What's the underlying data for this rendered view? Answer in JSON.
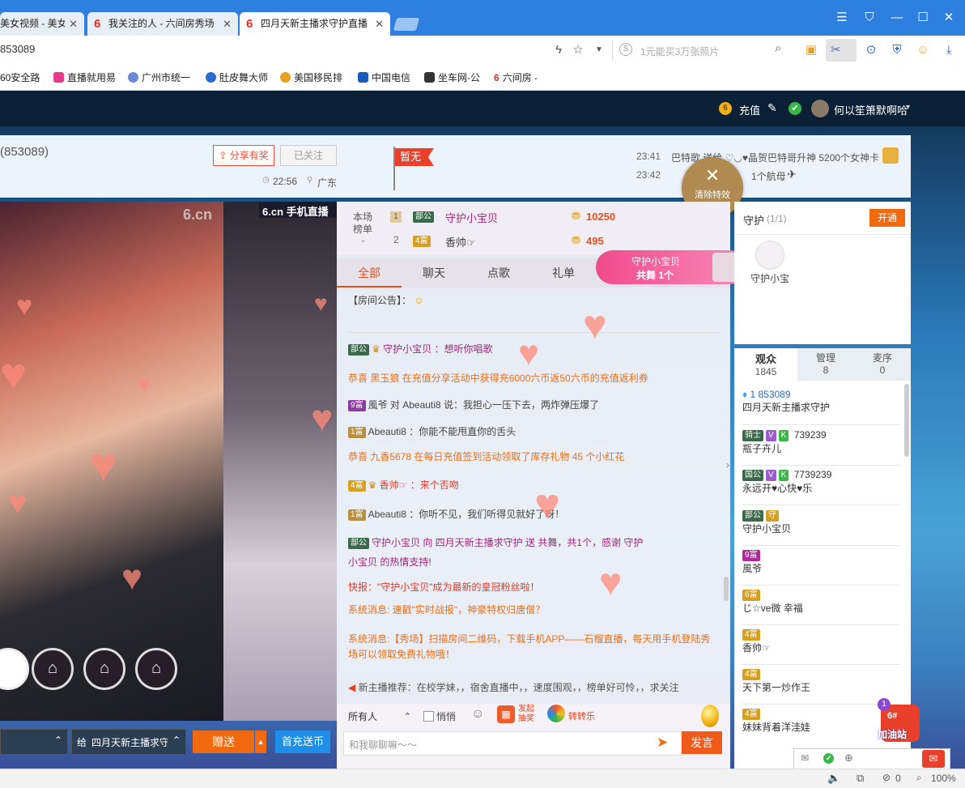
{
  "browser": {
    "tabs": [
      {
        "label": "美女视频 - 美女"
      },
      {
        "label": "我关注的人 - 六间房秀场"
      },
      {
        "label": "四月天新主播求守护直播"
      }
    ],
    "url": "853089",
    "search_placeholder": "1元能买3万张照片",
    "bookmarks": [
      "60安全路",
      "直播就用易",
      "广州市统一",
      "肚皮舞大师",
      "美国移民排",
      "中国电信",
      "坐车网-公",
      "六间房 -"
    ],
    "status": {
      "count": "0",
      "zoom": "100%"
    }
  },
  "site": {
    "recharge": "充值",
    "username": "何以笙箫默啊哈",
    "coin_icon_text": "6"
  },
  "room": {
    "id": "(853089)",
    "share_btn": "分享有奖",
    "followed_btn": "已关注",
    "time": "22:56",
    "location": "广东",
    "flag": "暂无",
    "notices": [
      {
        "time": "23:41",
        "text": "巴特歌 送给 ♡◡♥晶贺巴特哥升神 5200个女神卡"
      },
      {
        "time": "23:42",
        "text": "1个航母"
      }
    ],
    "clear_effects": "清除特效",
    "video_logo": "6.cn",
    "mobile_tag": "6.cn 手机直播"
  },
  "rank": {
    "label1": "本场",
    "label2": "榜单",
    "rows": [
      {
        "rank": "1",
        "badge": "部公",
        "name": "守护小宝贝",
        "score": "10250"
      },
      {
        "rank": "2",
        "badge": "4富",
        "name": "香帅☞",
        "score": "495"
      }
    ]
  },
  "chat_tabs": [
    "全部",
    "聊天",
    "点歌",
    "礼单"
  ],
  "dance_banner": {
    "name": "守护小宝贝",
    "line2": "共舞 1个"
  },
  "chat": [
    {
      "text": "【房间公告】：",
      "cls": ""
    },
    {
      "text": "守护小宝贝 ：想听你唱歌",
      "cls": "purple"
    },
    {
      "text": "恭喜 黑玉狼 在充值分享活动中获得充6000六币返50六币的充值返利券",
      "cls": "orange"
    },
    {
      "text": "風爷 对 Abeauti8 说：我担心一压下去，两炸弹压爆了",
      "cls": ""
    },
    {
      "text": "Abeauti8 ：你能不能甩直你的舌头",
      "cls": ""
    },
    {
      "text": "恭喜 九香5678 在每日充值签到活动领取了库存礼物 45 个小红花",
      "cls": "orange"
    },
    {
      "text": "香帅☞ ：来个否吻",
      "cls": "red"
    },
    {
      "text": "Abeauti8 ：你听不见，我们听得见就好了呀！",
      "cls": ""
    },
    {
      "text": "守护小宝贝 向 四月天新主播求守护 送 共舞，共1个，感谢 守护",
      "cls": "purple"
    },
    {
      "text": "小宝贝 的热情支持!",
      "cls": "purple"
    },
    {
      "text": "快报：\"守护小宝贝\"成为最新的皇冠粉丝啦！",
      "cls": "red"
    },
    {
      "text": "系统消息: 速戳\"实时战报\"，神豪特权归唐僧？",
      "cls": "orange"
    },
    {
      "text": "系统消息:【秀场】扫描房间二维码，下载手机APP——石榴直播，每天用手机登陆秀",
      "cls": "orange"
    },
    {
      "text": "场可以领取免费礼物哦！",
      "cls": "orange"
    }
  ],
  "recommend": "新主播推荐：在校学妹，，宿舍直播中，，速度围观，，榜单好可怜，，求关注",
  "chat_input": {
    "target": "所有人",
    "private": "悄悄",
    "launch": "发起抽奖",
    "spin": "转转乐",
    "placeholder": "和我聊聊嘛～～",
    "send": "发言"
  },
  "gift_bar": {
    "to_label": "给",
    "to_name": "四月天新主播求守",
    "gift_btn": "赠送",
    "recharge_btn": "首充送币"
  },
  "guard": {
    "title": "守护",
    "count": "(1/1)",
    "open_btn": "开通",
    "member": "守护小宝"
  },
  "user_tabs": [
    {
      "label": "观众",
      "count": "1845"
    },
    {
      "label": "管理",
      "count": "8"
    },
    {
      "label": "麦序",
      "count": "0"
    }
  ],
  "users": [
    {
      "line1": "1 853089",
      "line2": "四月天新主播求守护"
    },
    {
      "line1": "739239",
      "line2": "瓶子卉儿"
    },
    {
      "line1": "7739239",
      "line2": "永远开♥心快♥乐"
    },
    {
      "line1": "",
      "line2": "守护小宝贝"
    },
    {
      "line1": "",
      "line2": "風爷"
    },
    {
      "line1": "",
      "line2": "じ☆ve微 幸福"
    },
    {
      "line1": "",
      "line2": "香帅☞"
    },
    {
      "line1": "",
      "line2": "天下第一炒作王"
    },
    {
      "line1": "",
      "line2": "妹妹背着洋洼娃"
    }
  ],
  "gas_station": {
    "label": "加油站",
    "badge": "1",
    "num": "6#"
  },
  "colors": {
    "accent_red": "#e8401e",
    "accent_orange": "#f26a10",
    "blue_btn": "#1e8ee8",
    "chrome_blue": "#2f7fe0"
  }
}
